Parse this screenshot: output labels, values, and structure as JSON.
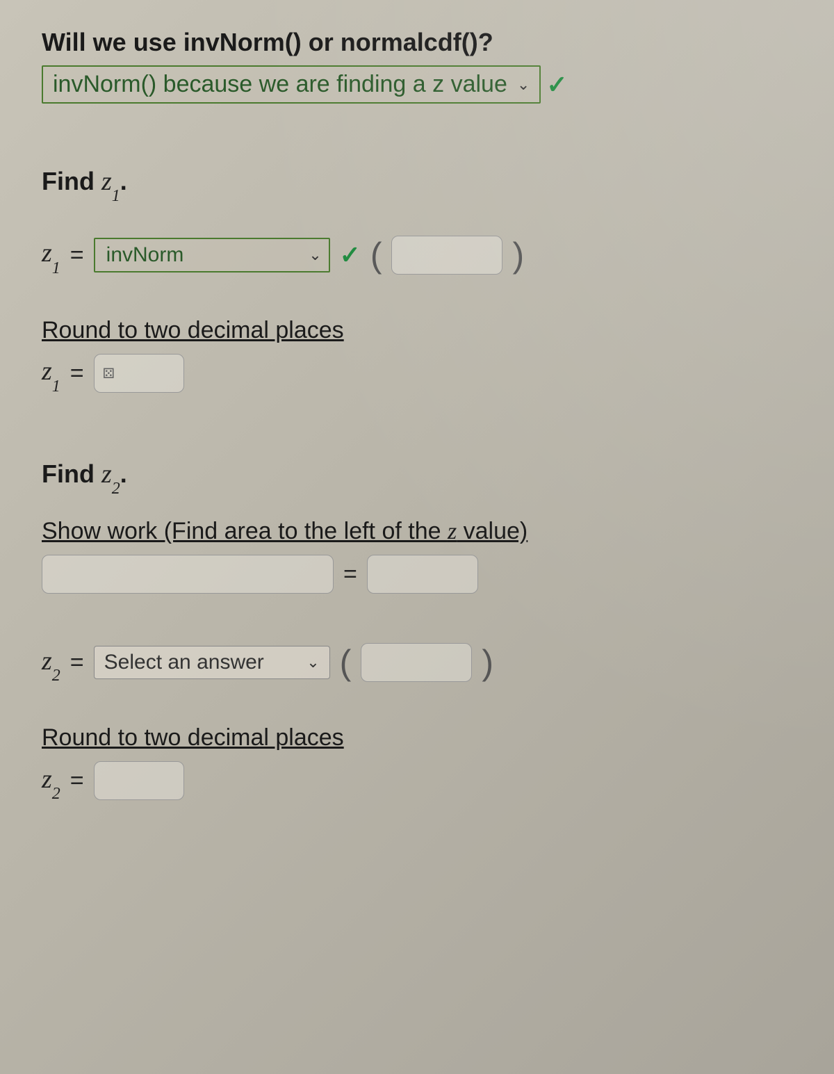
{
  "question1": {
    "prompt": "Will we use invNorm() or normalcdf()?",
    "selected": "invNorm() because we are finding a z value"
  },
  "z1": {
    "heading": "Find z₁.",
    "var_html": "z",
    "sub": "1",
    "eq": "=",
    "func_selected": "invNorm",
    "paren_open": "(",
    "paren_close": ")",
    "round_label": "Round to two decimal places",
    "round_value": ""
  },
  "z2": {
    "heading": "Find z₂.",
    "showwork": "Show work (Find area to the left of the z value)",
    "work_value": "",
    "work_result": "",
    "var_html": "z",
    "sub": "2",
    "eq": "=",
    "func_placeholder": "Select an answer",
    "paren_open": "(",
    "paren_close": ")",
    "round_label": "Round to two decimal places",
    "round_value": ""
  },
  "icons": {
    "chevron": "⌄",
    "check": "✓",
    "dice": "⚄"
  }
}
